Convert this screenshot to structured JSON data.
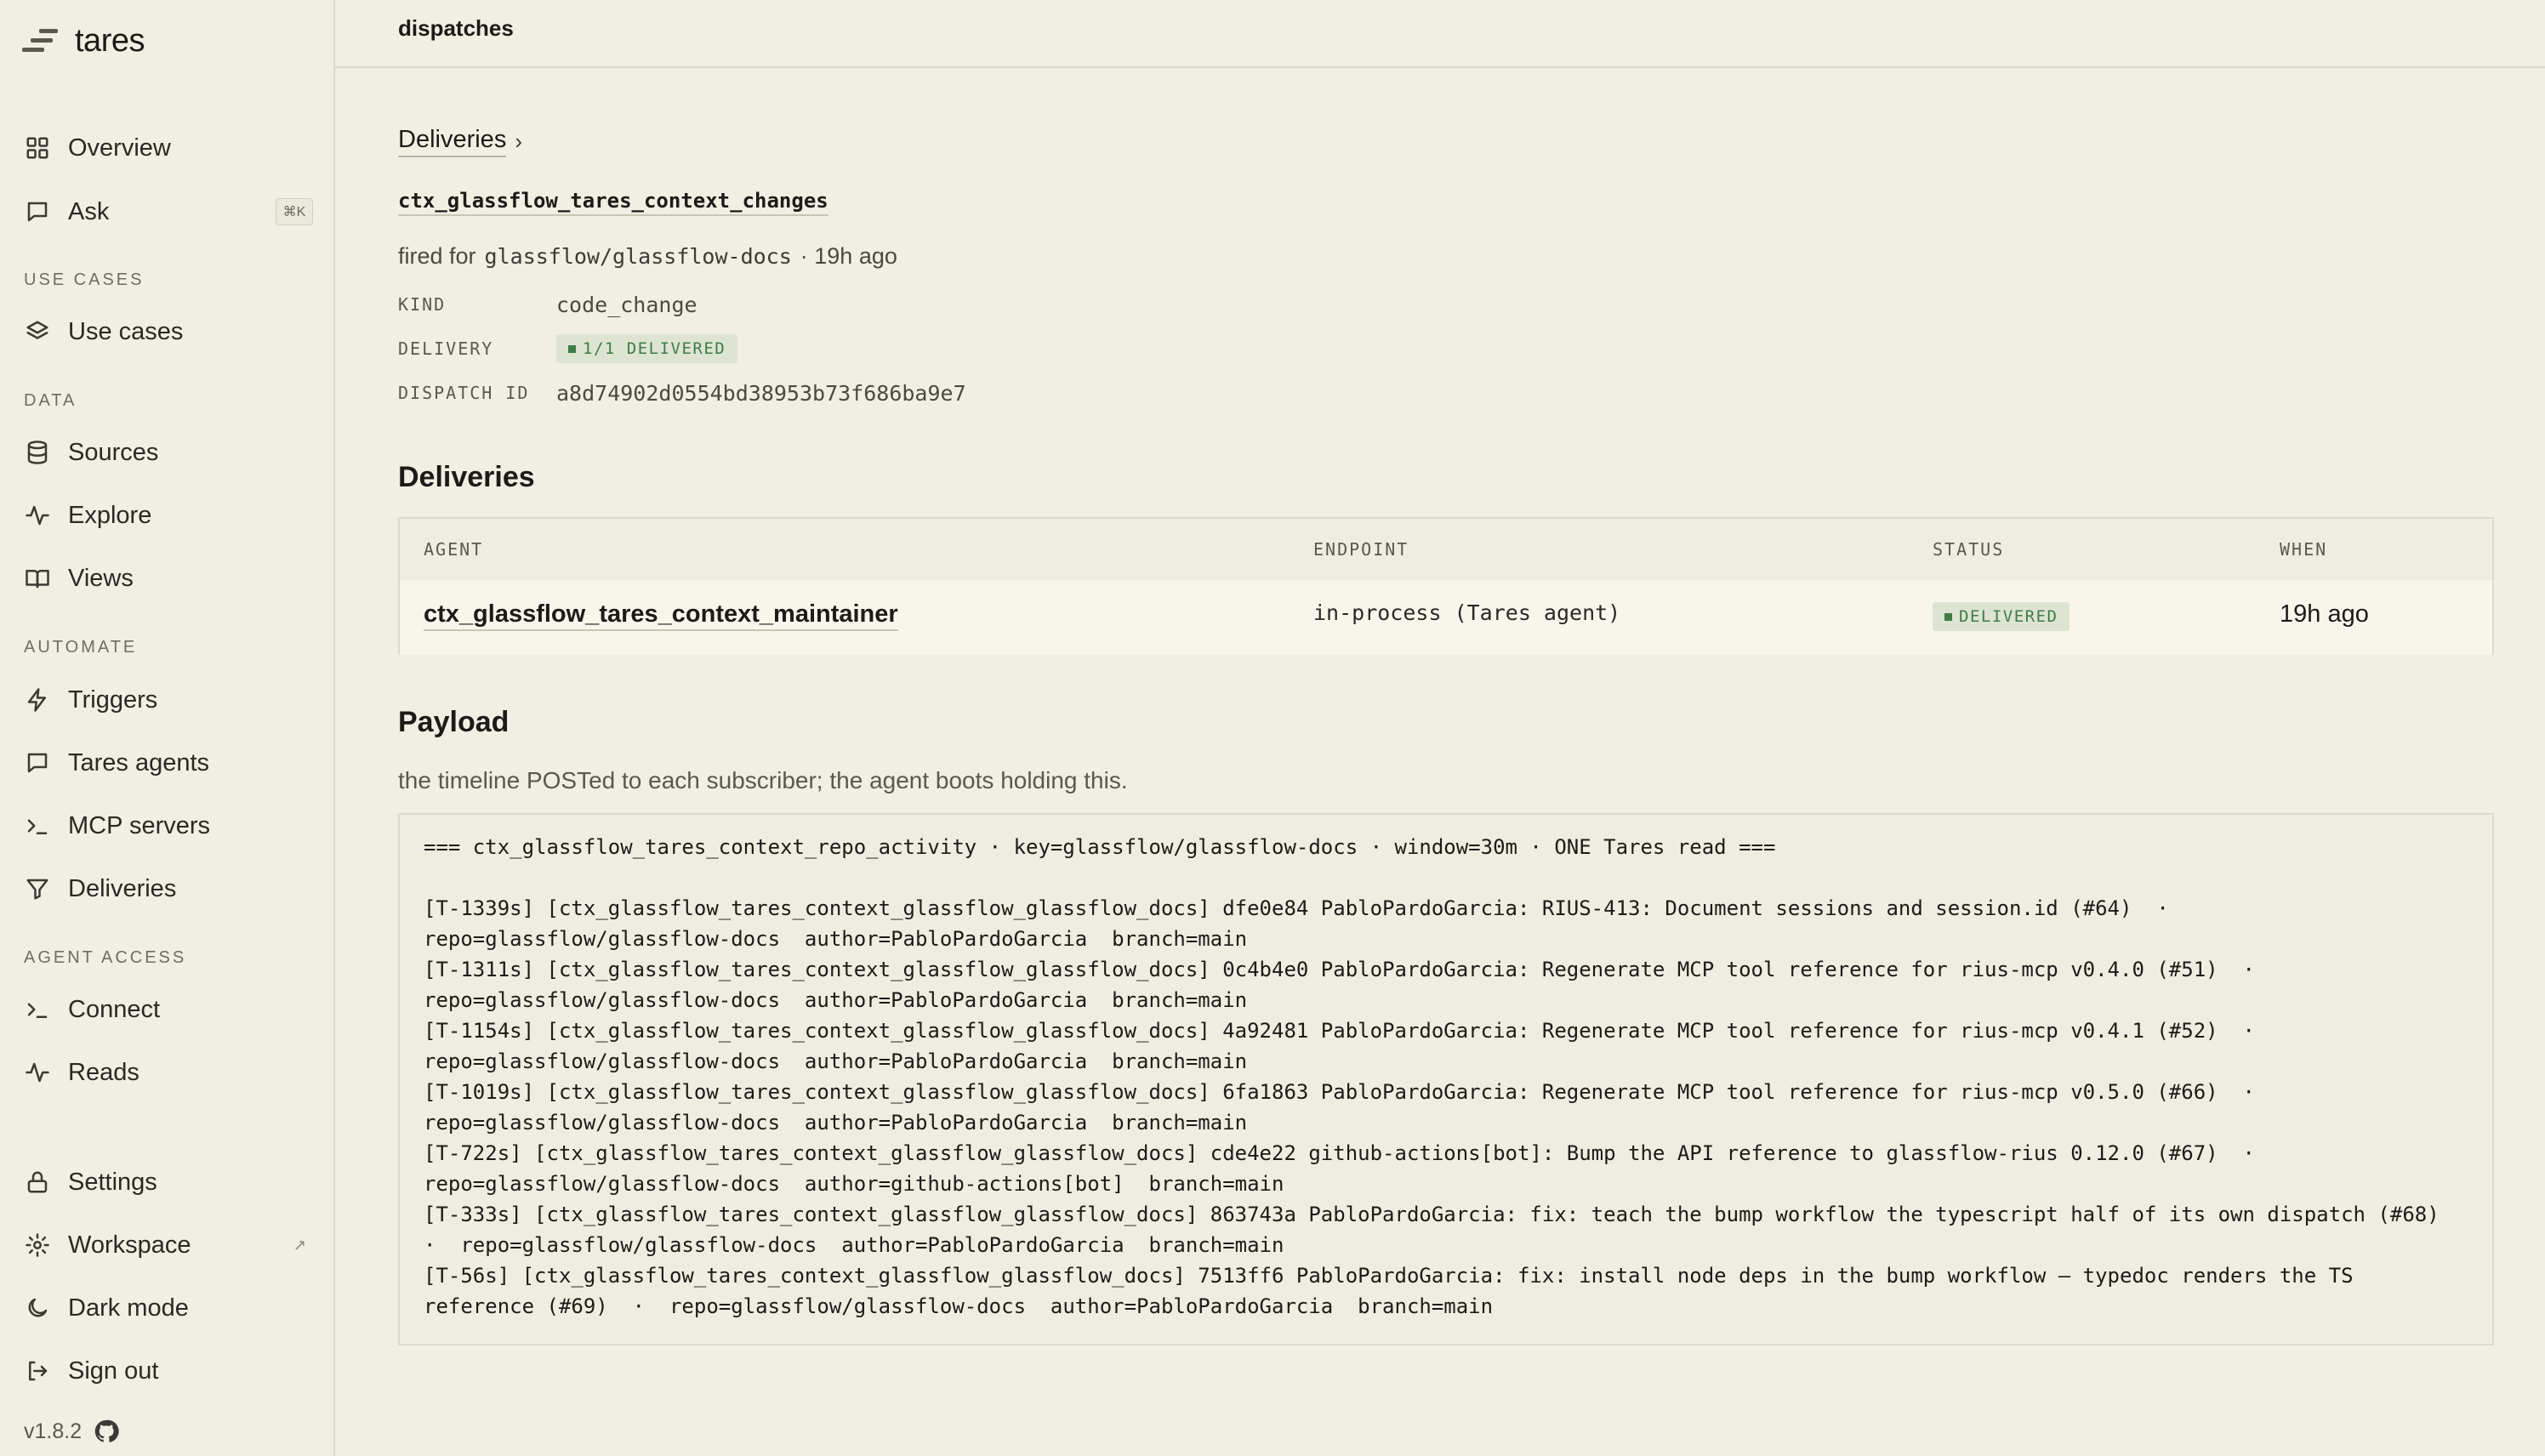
{
  "brand": {
    "name": "tares",
    "logo_icon": "tares-logo-icon"
  },
  "sidebar": {
    "items": [
      {
        "label": "Overview",
        "icon": "grid-icon"
      },
      {
        "label": "Ask",
        "icon": "chat-icon",
        "shortcut": "⌘K"
      }
    ],
    "sections": [
      {
        "label": "USE CASES",
        "items": [
          {
            "label": "Use cases",
            "icon": "layers-icon"
          }
        ]
      },
      {
        "label": "DATA",
        "items": [
          {
            "label": "Sources",
            "icon": "database-icon"
          },
          {
            "label": "Explore",
            "icon": "activity-icon"
          },
          {
            "label": "Views",
            "icon": "book-icon"
          }
        ]
      },
      {
        "label": "AUTOMATE",
        "items": [
          {
            "label": "Triggers",
            "icon": "lightning-icon"
          },
          {
            "label": "Tares agents",
            "icon": "chat-icon"
          },
          {
            "label": "MCP servers",
            "icon": "terminal-icon"
          },
          {
            "label": "Deliveries",
            "icon": "filter-icon"
          }
        ]
      },
      {
        "label": "AGENT ACCESS",
        "items": [
          {
            "label": "Connect",
            "icon": "terminal-icon"
          },
          {
            "label": "Reads",
            "icon": "activity-icon"
          }
        ]
      }
    ],
    "bottom": [
      {
        "label": "Settings",
        "icon": "lock-icon"
      },
      {
        "label": "Workspace",
        "icon": "gear-icon",
        "external": "↗"
      },
      {
        "label": "Dark mode",
        "icon": "moon-icon"
      },
      {
        "label": "Sign out",
        "icon": "sign-out-icon"
      }
    ],
    "version": "v1.8.2"
  },
  "header": {
    "title": "dispatches"
  },
  "breadcrumb": {
    "label": "Deliveries",
    "separator": "›"
  },
  "dispatch": {
    "name": "ctx_glassflow_tares_context_changes",
    "fired_prefix": "fired for",
    "repo": "glassflow/glassflow-docs",
    "fired_suffix": "· 19h ago",
    "kind_label": "KIND",
    "kind": "code_change",
    "delivery_label": "DELIVERY",
    "delivery_status": "1/1 DELIVERED",
    "id_label": "DISPATCH ID",
    "id": "a8d74902d0554bd38953b73f686ba9e7"
  },
  "deliveries": {
    "title": "Deliveries",
    "columns": [
      "AGENT",
      "ENDPOINT",
      "STATUS",
      "WHEN"
    ],
    "rows": [
      {
        "agent": "ctx_glassflow_tares_context_maintainer",
        "endpoint": "in-process (Tares agent)",
        "status": "DELIVERED",
        "when": "19h ago"
      }
    ]
  },
  "payload": {
    "title": "Payload",
    "description": "the timeline POSTed to each subscriber; the agent boots holding this.",
    "text": "=== ctx_glassflow_tares_context_repo_activity · key=glassflow/glassflow-docs · window=30m · ONE Tares read ===\n\n[T-1339s] [ctx_glassflow_tares_context_glassflow_glassflow_docs] dfe0e84 PabloPardoGarcia: RIUS-413: Document sessions and session.id (#64)  ·\nrepo=glassflow/glassflow-docs  author=PabloPardoGarcia  branch=main\n[T-1311s] [ctx_glassflow_tares_context_glassflow_glassflow_docs] 0c4b4e0 PabloPardoGarcia: Regenerate MCP tool reference for rius-mcp v0.4.0 (#51)  ·\nrepo=glassflow/glassflow-docs  author=PabloPardoGarcia  branch=main\n[T-1154s] [ctx_glassflow_tares_context_glassflow_glassflow_docs] 4a92481 PabloPardoGarcia: Regenerate MCP tool reference for rius-mcp v0.4.1 (#52)  ·\nrepo=glassflow/glassflow-docs  author=PabloPardoGarcia  branch=main\n[T-1019s] [ctx_glassflow_tares_context_glassflow_glassflow_docs] 6fa1863 PabloPardoGarcia: Regenerate MCP tool reference for rius-mcp v0.5.0 (#66)  ·\nrepo=glassflow/glassflow-docs  author=PabloPardoGarcia  branch=main\n[T-722s] [ctx_glassflow_tares_context_glassflow_glassflow_docs] cde4e22 github-actions[bot]: Bump the API reference to glassflow-rius 0.12.0 (#67)  ·\nrepo=glassflow/glassflow-docs  author=github-actions[bot]  branch=main\n[T-333s] [ctx_glassflow_tares_context_glassflow_glassflow_docs] 863743a PabloPardoGarcia: fix: teach the bump workflow the typescript half of its own dispatch (#68)\n·  repo=glassflow/glassflow-docs  author=PabloPardoGarcia  branch=main\n[T-56s] [ctx_glassflow_tares_context_glassflow_glassflow_docs] 7513ff6 PabloPardoGarcia: fix: install node deps in the bump workflow — typedoc renders the TS\nreference (#69)  ·  repo=glassflow/glassflow-docs  author=PabloPardoGarcia  branch=main"
  }
}
